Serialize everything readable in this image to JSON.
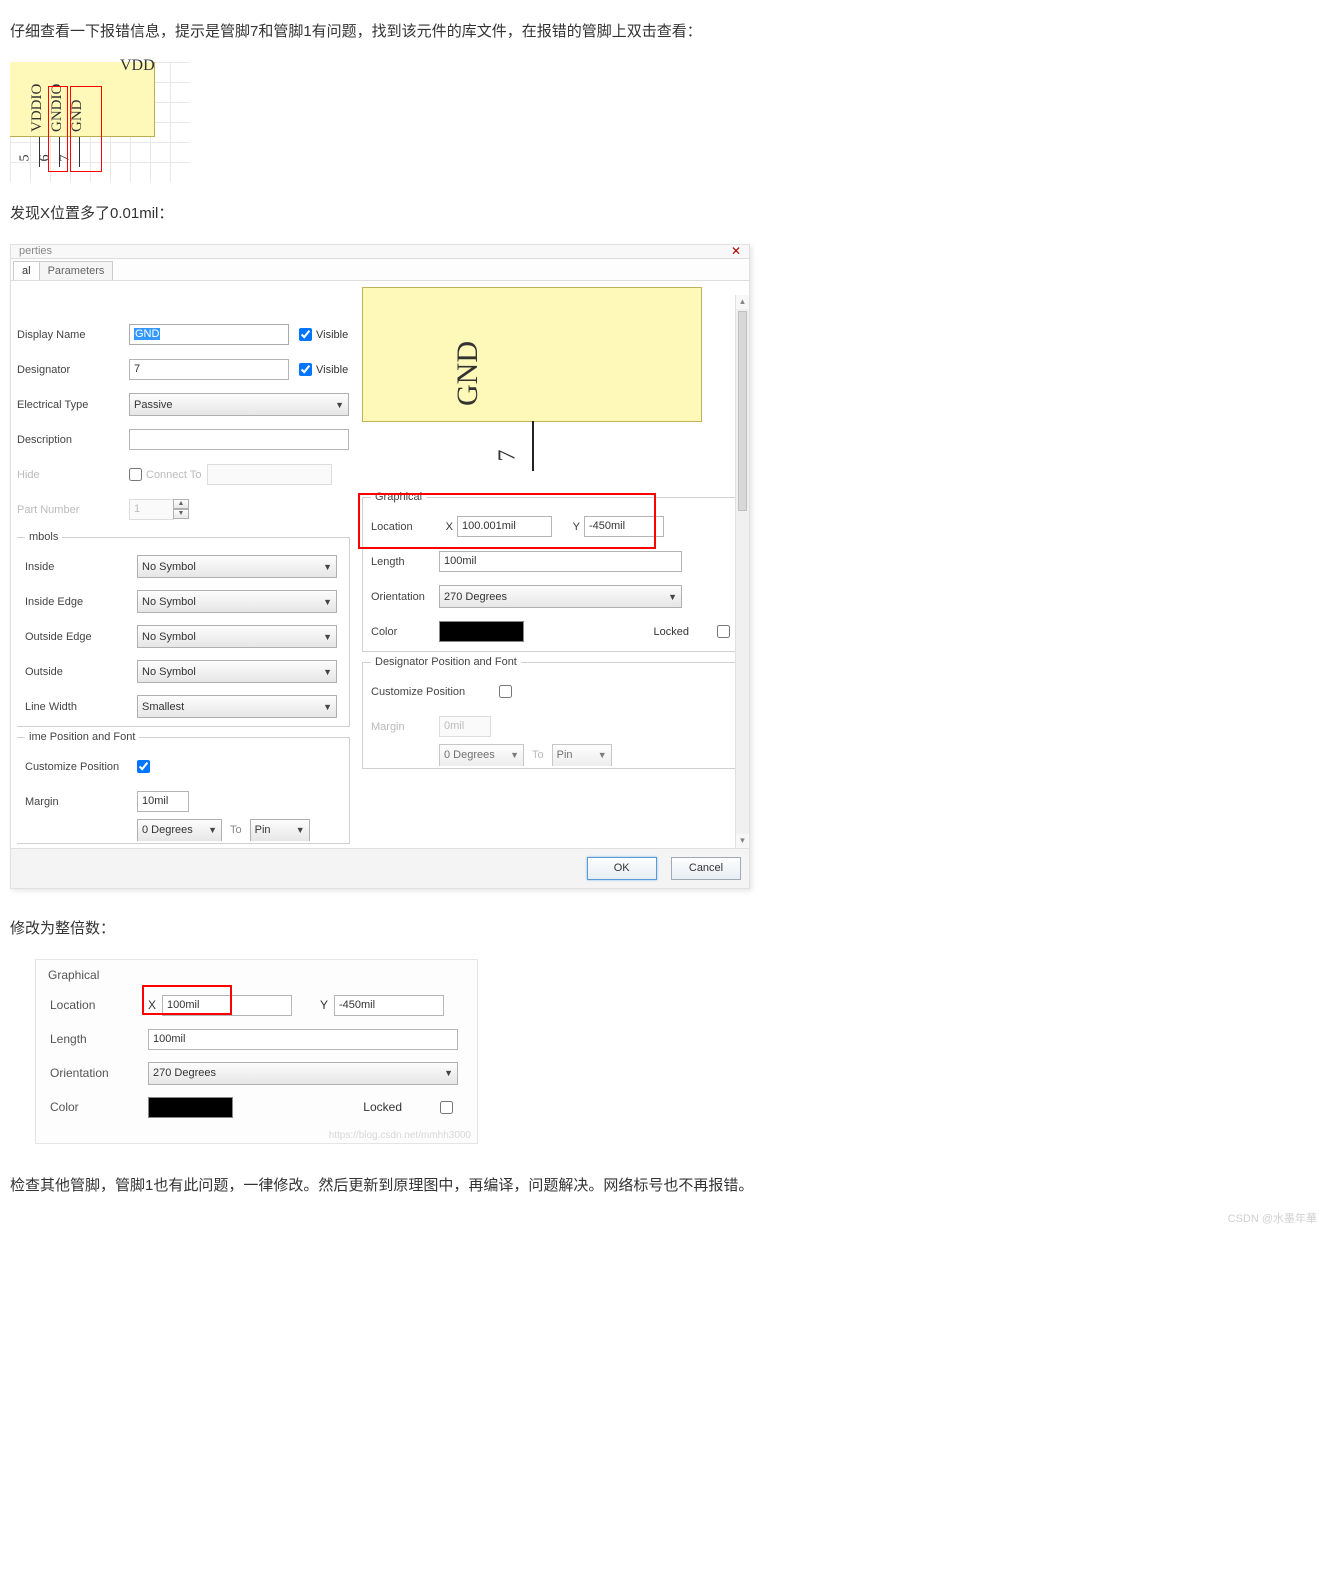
{
  "article": {
    "p1": "仔细查看一下报错信息，提示是管脚7和管脚1有问题，找到该元件的库文件，在报错的管脚上双击查看：",
    "p2": "发现X位置多了0.01mil：",
    "p3": "修改为整倍数：",
    "p4": "检查其他管脚，管脚1也有此问题，一律修改。然后更新到原理图中，再编译，问题解决。网络标号也不再报错。",
    "watermark_bottom": "CSDN @水墨年華"
  },
  "pins": {
    "vdd": "VDD",
    "pin5_name": "VDDIO",
    "pin6_name": "GNDIO",
    "pin7_name": "GND",
    "pin5_num": "5",
    "pin6_num": "6",
    "pin7_num": "7"
  },
  "dialog": {
    "title": "perties",
    "close": "✕",
    "tabs": {
      "active": "al",
      "inactive": "Parameters"
    },
    "labels": {
      "displayName": "Display Name",
      "designator": "Designator",
      "electricalType": "Electrical Type",
      "description": "Description",
      "hide": "Hide",
      "partNumber": "Part Number",
      "visible": "Visible",
      "connectTo": "Connect To"
    },
    "values": {
      "displayName": "GND",
      "designator": "7",
      "electricalType": "Passive",
      "description": "",
      "partNumber": "1",
      "visible1": true,
      "visible2": true,
      "hide": false
    },
    "symbols": {
      "group": "mbols",
      "inside": "Inside",
      "insideEdge": "Inside Edge",
      "outsideEdge": "Outside Edge",
      "outside": "Outside",
      "lineWidth": "Line Width",
      "noSymbol": "No Symbol",
      "smallest": "Smallest"
    },
    "graphical": {
      "group": "Graphical",
      "location": "Location",
      "x_lbl": "X",
      "y_lbl": "Y",
      "x": "100.001mil",
      "y": "-450mil",
      "length_lbl": "Length",
      "length": "100mil",
      "orientation_lbl": "Orientation",
      "orientation": "270 Degrees",
      "color_lbl": "Color",
      "locked_lbl": "Locked",
      "locked": false
    },
    "preview": {
      "name": "GND",
      "num": "7"
    },
    "namePos": {
      "group": "ime Position and Font",
      "customize": "Customize Position",
      "margin_lbl": "Margin",
      "margin": "10mil",
      "deg": "0 Degrees",
      "to": "To",
      "pin": "Pin"
    },
    "desigPos": {
      "group": "Designator Position and Font",
      "customize": "Customize Position",
      "margin_lbl": "Margin",
      "margin": "0mil",
      "deg": "0 Degrees",
      "to": "To",
      "pin": "Pin"
    },
    "buttons": {
      "ok": "OK",
      "cancel": "Cancel"
    }
  },
  "second": {
    "group": "Graphical",
    "location": "Location",
    "x_lbl": "X",
    "y_lbl": "Y",
    "x": "100mil",
    "y": "-450mil",
    "length_lbl": "Length",
    "length": "100mil",
    "orientation_lbl": "Orientation",
    "orientation": "270 Degrees",
    "color_lbl": "Color",
    "locked_lbl": "Locked",
    "wm": "https://blog.csdn.net/mmhh3000"
  }
}
